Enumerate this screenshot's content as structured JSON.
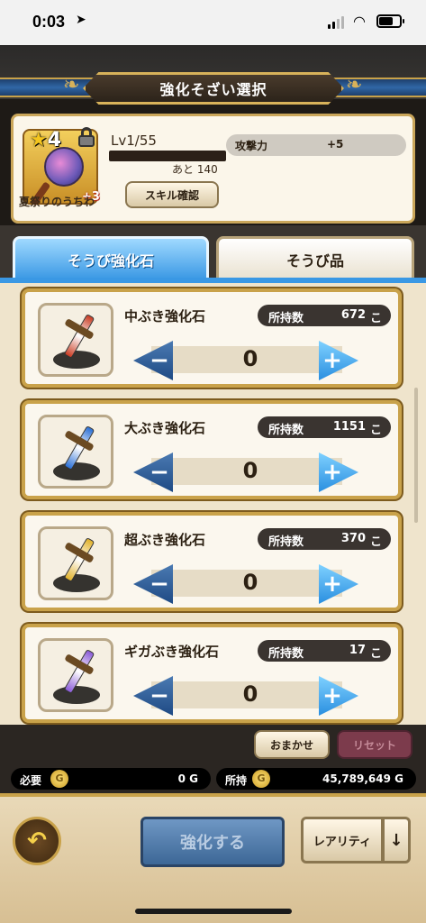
{
  "status": {
    "time": "0:03"
  },
  "title": "強化そざい選択",
  "item": {
    "stars": "4",
    "name": "夏祭りのうちわ",
    "plus": "+3",
    "level": "Lv1/55",
    "remaining": "あと 140",
    "skill_button": "スキル確認",
    "stat_label": "攻撃力",
    "stat_value": "+5"
  },
  "tabs": [
    {
      "label": "そうび強化石",
      "active": true
    },
    {
      "label": "そうび品",
      "active": false
    }
  ],
  "materials": [
    {
      "name": "中ぶき強化石",
      "owned_label": "所持数",
      "owned": "672",
      "unit": "こ",
      "count": "0",
      "blade_color": "#c93b22"
    },
    {
      "name": "大ぶき強化石",
      "owned_label": "所持数",
      "owned": "1151",
      "unit": "こ",
      "count": "0",
      "blade_color": "#2a6fd6"
    },
    {
      "name": "超ぶき強化石",
      "owned_label": "所持数",
      "owned": "370",
      "unit": "こ",
      "count": "0",
      "blade_color": "#e2b22a"
    },
    {
      "name": "ギガぶき強化石",
      "owned_label": "所持数",
      "owned": "17",
      "unit": "こ",
      "count": "0",
      "blade_color": "#8a5ad8"
    }
  ],
  "actions": {
    "auto": "おまかせ",
    "reset": "リセット"
  },
  "gold": {
    "required_label": "必要",
    "required_value": "0 G",
    "owned_label": "所持",
    "owned_value": "45,789,649 G",
    "coin": "G"
  },
  "footer": {
    "enhance": "強化する",
    "rarity": "レアリティ",
    "sort_icon": "↓",
    "back_icon": "↶"
  }
}
